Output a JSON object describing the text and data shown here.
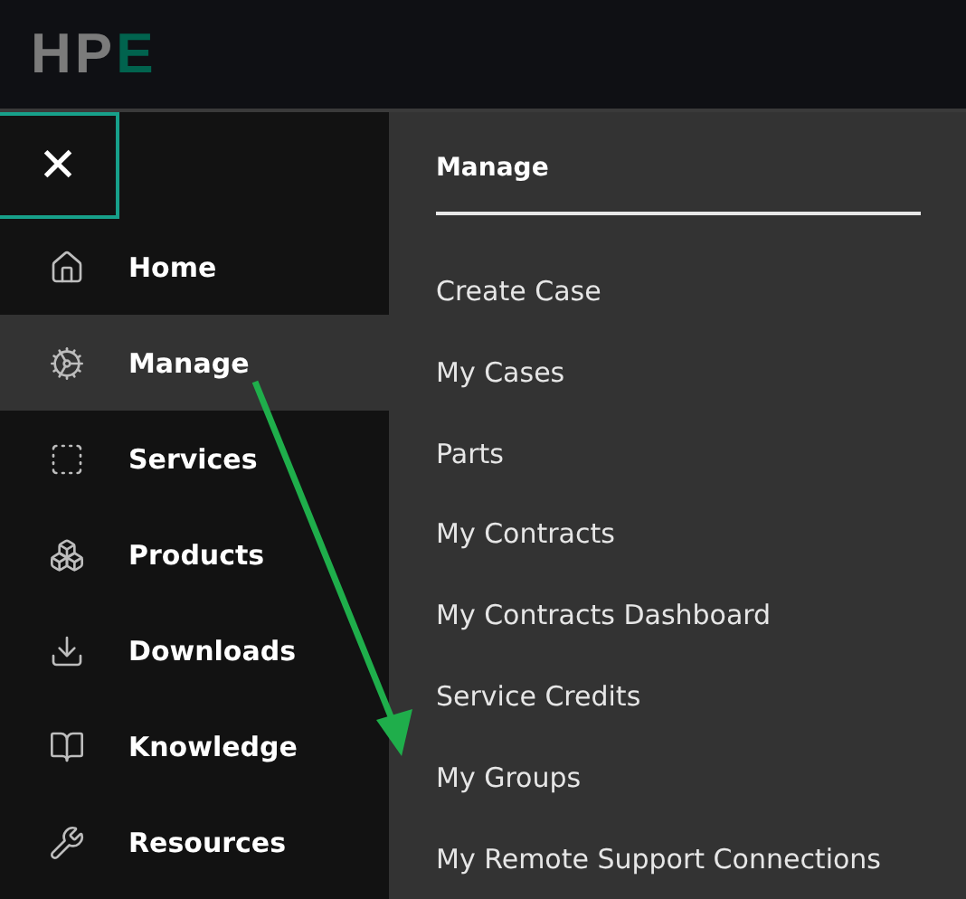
{
  "header": {
    "logo": {
      "text": "HP",
      "accent": "E"
    }
  },
  "close_button": {
    "label": "✕"
  },
  "sidebar": {
    "items": [
      {
        "label": "Home",
        "selected": false
      },
      {
        "label": "Manage",
        "selected": true
      },
      {
        "label": "Services",
        "selected": false
      },
      {
        "label": "Products",
        "selected": false
      },
      {
        "label": "Downloads",
        "selected": false
      },
      {
        "label": "Knowledge",
        "selected": false
      },
      {
        "label": "Resources",
        "selected": false
      }
    ]
  },
  "submenu": {
    "title": "Manage",
    "items": [
      "Create Case",
      "My Cases",
      "Parts",
      "My Contracts",
      "My Contracts Dashboard",
      "Service Credits",
      "My Groups",
      "My Remote Support Connections"
    ]
  }
}
